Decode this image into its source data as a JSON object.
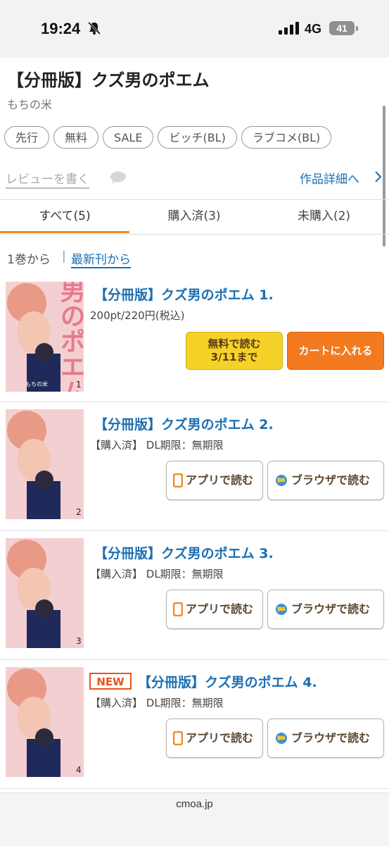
{
  "status_bar": {
    "time": "19:24",
    "network": "4G",
    "battery": "41"
  },
  "header": {
    "title": "【分冊版】クズ男のポエム",
    "author": "もちの米"
  },
  "tags": [
    "先行",
    "無料",
    "SALE",
    "ビッチ(BL)",
    "ラブコメ(BL)"
  ],
  "actions": {
    "review": "レビューを書く",
    "details": "作品詳細へ"
  },
  "tabs": [
    {
      "label": "すべて(5)",
      "active": true
    },
    {
      "label": "購入済(3)",
      "active": false
    },
    {
      "label": "未購入(2)",
      "active": false
    }
  ],
  "sort": {
    "from_first": "1巻から",
    "separator": "|",
    "from_latest": "最新刊から"
  },
  "cover": {
    "title_text": "クズ男のポエム",
    "author_text": "もちの米"
  },
  "volumes": [
    {
      "title": "【分冊版】クズ男のポエム 1.",
      "price": "200pt/220円(税込)",
      "volume_number": "1",
      "free_read_line1": "無料で読む",
      "free_read_line2": "3/11まで",
      "cart": "カートに入れる"
    },
    {
      "title": "【分冊版】クズ男のポエム 2.",
      "status": "【購入済】 DL期限：無期限",
      "volume_number": "2",
      "app_read": "アプリで読む",
      "browser_read": "ブラウザで読む"
    },
    {
      "title": "【分冊版】クズ男のポエム 3.",
      "status": "【購入済】 DL期限：無期限",
      "volume_number": "3",
      "app_read": "アプリで読む",
      "browser_read": "ブラウザで読む"
    },
    {
      "badge": "NEW",
      "title": "【分冊版】クズ男のポエム 4.",
      "status": "【購入済】 DL期限：無期限",
      "volume_number": "4",
      "app_read": "アプリで読む",
      "browser_read": "ブラウザで読む"
    }
  ],
  "url_bar": {
    "domain": "cmoa.jp"
  },
  "colors": {
    "link": "#1b6fb3",
    "tab_active": "#f08a1b",
    "free_button": "#f5d228",
    "cart_button": "#f37a1f",
    "new_badge": "#e8551c"
  },
  "icons": [
    "bell-muted-icon",
    "signal-icon",
    "speech-bubble-icon",
    "chevron-right-icon",
    "phone-icon",
    "globe-icon"
  ]
}
